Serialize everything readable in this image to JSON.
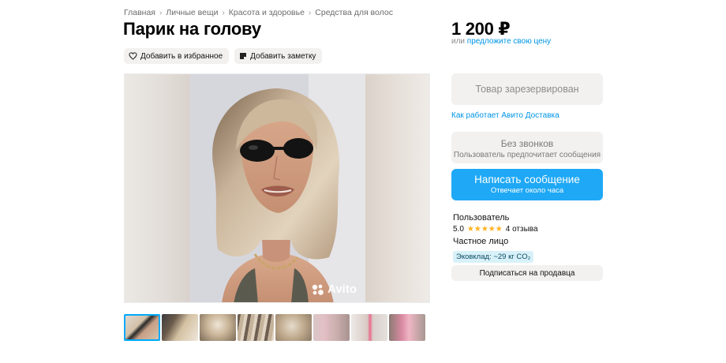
{
  "breadcrumb": [
    "Главная",
    "Личные вещи",
    "Красота и здоровье",
    "Средства для волос"
  ],
  "title": "Парик на голову",
  "actions": {
    "favorite": "Добавить в избранное",
    "note": "Добавить заметку"
  },
  "price": {
    "value": "1 200 ₽",
    "or": "или",
    "offer_link": "предложите свою цену"
  },
  "reserved_label": "Товар зарезервирован",
  "delivery_link": "Как работает Авито Доставка",
  "no_calls": {
    "title": "Без звонков",
    "subtitle": "Пользователь предпочитает сообщения"
  },
  "message_button": {
    "title": "Написать сообщение",
    "subtitle": "Отвечает около часа"
  },
  "seller": {
    "name": "Пользователь",
    "rating": "5.0",
    "stars_filled": 5,
    "reviews": "4 отзыва",
    "type": "Частное лицо",
    "eco": "Эковклад: ~29 кг CO₂"
  },
  "subscribe_label": "Подписаться на продавца",
  "watermark": "Avito",
  "thumbnails_count": 8,
  "active_thumbnail": 1,
  "colors": {
    "accent": "#1ea8f5",
    "link": "#0095e6",
    "star": "#ffb21e"
  }
}
